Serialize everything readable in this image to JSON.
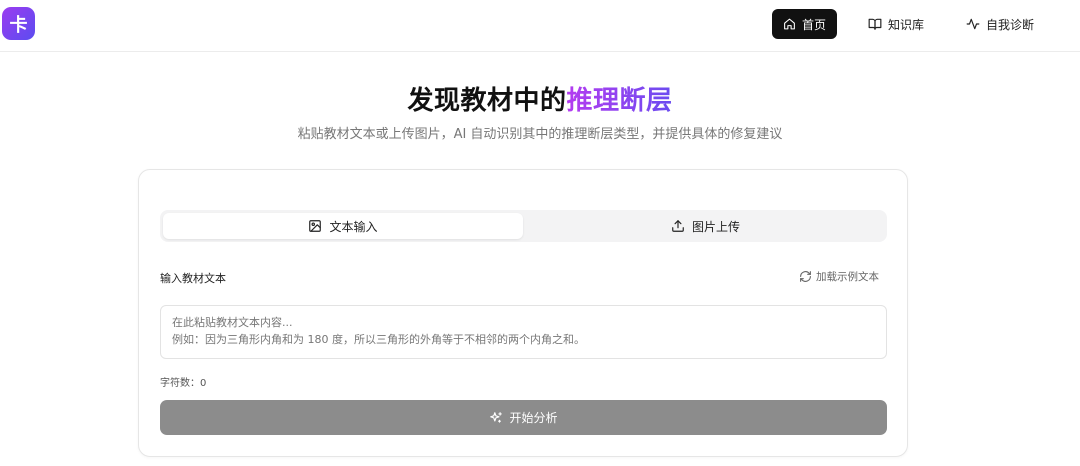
{
  "logo": {
    "glyph": "卡"
  },
  "nav": {
    "home": "首页",
    "knowledge_base": "知识库",
    "self_diagnosis": "自我诊断"
  },
  "hero": {
    "title_prefix": "发现教材中的",
    "title_highlight": "推理断层",
    "subtitle": "粘贴教材文本或上传图片，AI 自动识别其中的推理断层类型，并提供具体的修复建议"
  },
  "tabs": {
    "text_input": "文本输入",
    "image_upload": "图片上传"
  },
  "form": {
    "label": "输入教材文本",
    "load_sample": "加载示例文本",
    "placeholder_line1": "在此粘贴教材文本内容...",
    "placeholder_line2": "例如：因为三角形内角和为 180 度，所以三角形的外角等于不相邻的两个内角之和。",
    "char_count": "字符数：0",
    "submit": "开始分析"
  },
  "colors": {
    "brand_gradient_start": "#9b3cf0",
    "brand_gradient_end": "#5b4cf0",
    "nav_active_bg": "#111111",
    "button_disabled_bg": "#8c8c8c"
  },
  "icons": [
    "home-icon",
    "book-open-icon",
    "activity-icon",
    "image-icon",
    "upload-icon",
    "refresh-icon",
    "sparkles-icon"
  ]
}
